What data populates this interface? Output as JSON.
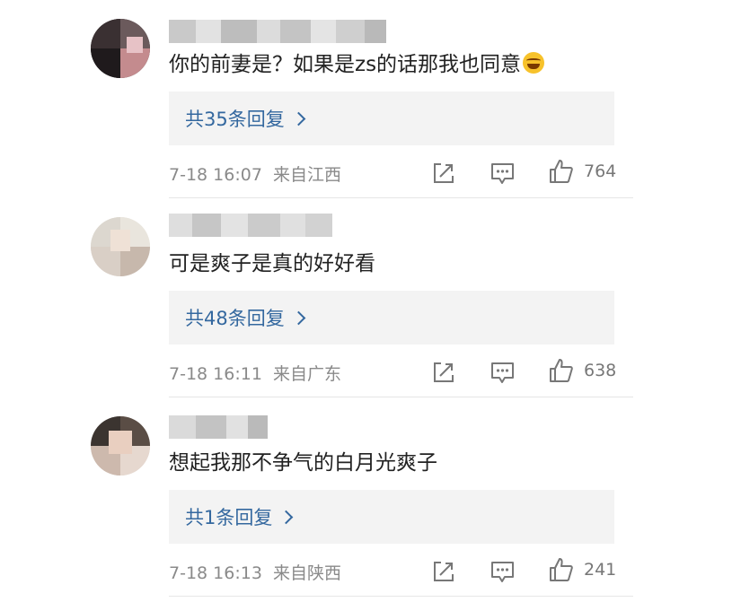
{
  "comments": [
    {
      "username": "",
      "text": "你的前妻是？如果是zs的话那我也同意",
      "emoji": "grinning-sweat-emoji",
      "replies_label": "共35条回复",
      "timestamp": "7-18 16:07",
      "location": "来自江西",
      "likes": "764"
    },
    {
      "username": "",
      "text": "可是爽子是真的好好看",
      "replies_label": "共48条回复",
      "timestamp": "7-18 16:11",
      "location": "来自广东",
      "likes": "638"
    },
    {
      "username": "",
      "text": "想起我那不争气的白月光爽子",
      "replies_label": "共1条回复",
      "timestamp": "7-18 16:13",
      "location": "来自陕西",
      "likes": "241"
    }
  ],
  "colors": {
    "link": "#34689f",
    "reply_bg": "#f3f3f3",
    "meta": "#8a8a8a"
  }
}
